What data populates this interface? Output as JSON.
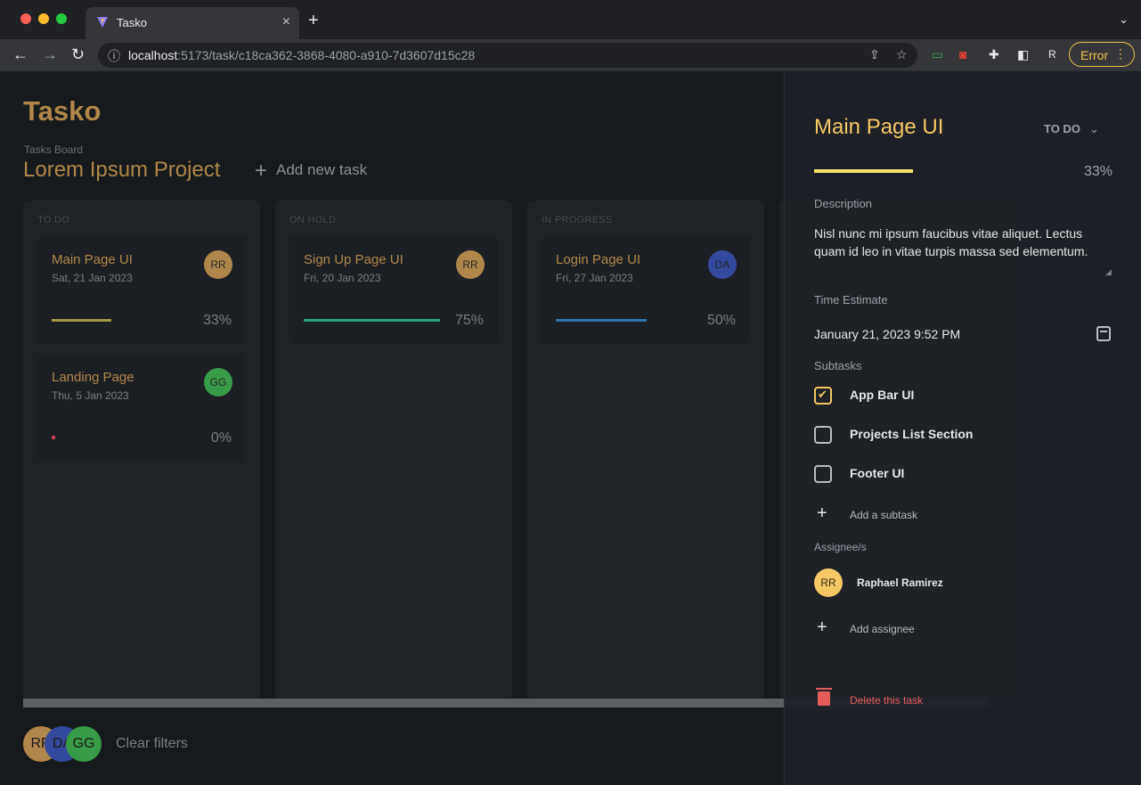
{
  "browser": {
    "tab_title": "Tasko",
    "tab_close": "×",
    "new_tab": "+",
    "url_host": "localhost",
    "url_path": ":5173/task/c18ca362-3868-4080-a910-7d3607d15c28",
    "profile_initial": "R",
    "error_label": "Error",
    "icons": [
      "back-arrow-icon",
      "forward-arrow-icon",
      "reload-icon",
      "info-icon",
      "share-icon",
      "star-icon",
      "extension-icon",
      "puzzle-icon",
      "sidebar-icon",
      "kebab-menu-icon"
    ]
  },
  "app": {
    "brand": "Tasko",
    "breadcrumb": "Tasks Board",
    "project_title": "Lorem Ipsum Project",
    "add_task": "Add new task",
    "columns": [
      {
        "title": "TO DO",
        "cards": [
          {
            "title": "Main Page UI",
            "date": "Sat, 21 Jan 2023",
            "avatar": "RR",
            "avatar_color": "#c99a55",
            "progress_label": "33%",
            "progress": 0.33,
            "bar_color": "#b9ae4c"
          },
          {
            "title": "Landing Page",
            "date": "Thu, 5 Jan 2023",
            "avatar": "GG",
            "avatar_color": "#3fb153",
            "progress_label": "0%",
            "progress": 0.0,
            "bar_color": "#e04a57"
          }
        ]
      },
      {
        "title": "ON HOLD",
        "cards": [
          {
            "title": "Sign Up Page UI",
            "date": "Fri, 20 Jan 2023",
            "avatar": "RR",
            "avatar_color": "#c99a55",
            "progress_label": "75%",
            "progress": 0.75,
            "bar_color": "#35b58e"
          }
        ]
      },
      {
        "title": "IN PROGRESS",
        "cards": [
          {
            "title": "Login Page UI",
            "date": "Fri, 27 Jan 2023",
            "avatar": "DA",
            "avatar_color": "#3d55b5",
            "progress_label": "50%",
            "progress": 0.5,
            "bar_color": "#3a82c4"
          }
        ]
      }
    ],
    "filter_avatars": [
      {
        "initials": "RR",
        "color": "#c99a55"
      },
      {
        "initials": "DA",
        "color": "#3d55b5"
      },
      {
        "initials": "GG",
        "color": "#3fb153"
      }
    ],
    "clear_filters": "Clear filters"
  },
  "drawer": {
    "title": "Main Page UI",
    "status": "TO DO",
    "progress_label": "33%",
    "progress": 0.33,
    "description_label": "Description",
    "description": "Nisl nunc mi ipsum faucibus vitae aliquet. Lectus quam id leo in vitae turpis massa sed elementum.",
    "time_label": "Time Estimate",
    "time_value": "January 21, 2023 9:52 PM",
    "subtasks_label": "Subtasks",
    "subtasks": [
      {
        "label": "App Bar UI",
        "checked": true
      },
      {
        "label": "Projects List Section",
        "checked": false
      },
      {
        "label": "Footer UI",
        "checked": false
      }
    ],
    "add_subtask": "Add a subtask",
    "assignees_label": "Assignee/s",
    "assignee_initials": "RR",
    "assignee_name": "Raphael Ramirez",
    "add_assignee": "Add assignee",
    "delete_label": "Delete this task"
  }
}
